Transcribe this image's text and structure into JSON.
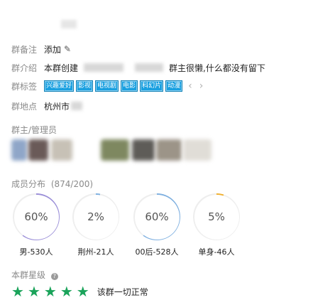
{
  "info": {
    "remark_label": "群备注",
    "remark_value": "添加",
    "intro_label": "群介绍",
    "intro_prefix": "本群创建",
    "intro_suffix": "群主很懒,什么都没有留下",
    "tags_label": "群标签",
    "tags": [
      "兴趣爱好",
      "影视",
      "电视剧",
      "电影",
      "科幻片",
      "动漫"
    ],
    "location_label": "群地点",
    "location_value": "杭州市"
  },
  "owner": {
    "section_title": "群主/管理员"
  },
  "members": {
    "section_title": "成员分布",
    "count_text": "(874/200)",
    "stats": [
      {
        "value": "60%",
        "label": "男-530人",
        "percent": 60,
        "color": "#9b8fd8"
      },
      {
        "value": "2%",
        "label": "荆州-21人",
        "percent": 2,
        "color": "#7fb0e0"
      },
      {
        "value": "60%",
        "label": "00后-528人",
        "percent": 60,
        "color": "#7fb0e0"
      },
      {
        "value": "5%",
        "label": "单身-46人",
        "percent": 5,
        "color": "#f0b030"
      }
    ]
  },
  "rating": {
    "section_title": "本群星级",
    "stars": 5,
    "status": "该群一切正常"
  }
}
